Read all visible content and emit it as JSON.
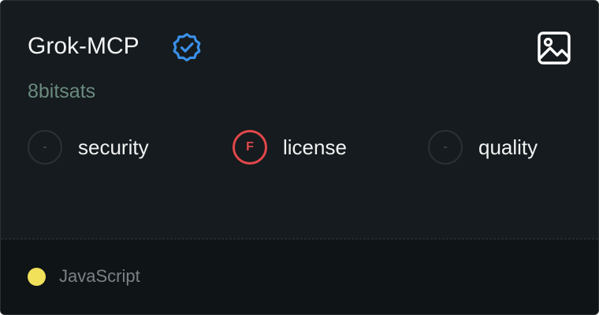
{
  "repo": {
    "name": "Grok-MCP",
    "author": "8bitsats",
    "verified_icon": "verified-badge-icon",
    "image_icon": "image-icon"
  },
  "metrics": [
    {
      "grade": "-",
      "label": "security",
      "status": "none"
    },
    {
      "grade": "F",
      "label": "license",
      "status": "fail"
    },
    {
      "grade": "-",
      "label": "quality",
      "status": "none"
    }
  ],
  "language": {
    "name": "JavaScript",
    "color": "#f1e05a"
  },
  "colors": {
    "card_background": "#151b1e",
    "footer_background": "#0f1417",
    "accent_verified": "#3b8fe8",
    "grade_fail": "#e2474a",
    "author_text": "#6b8a7e"
  }
}
